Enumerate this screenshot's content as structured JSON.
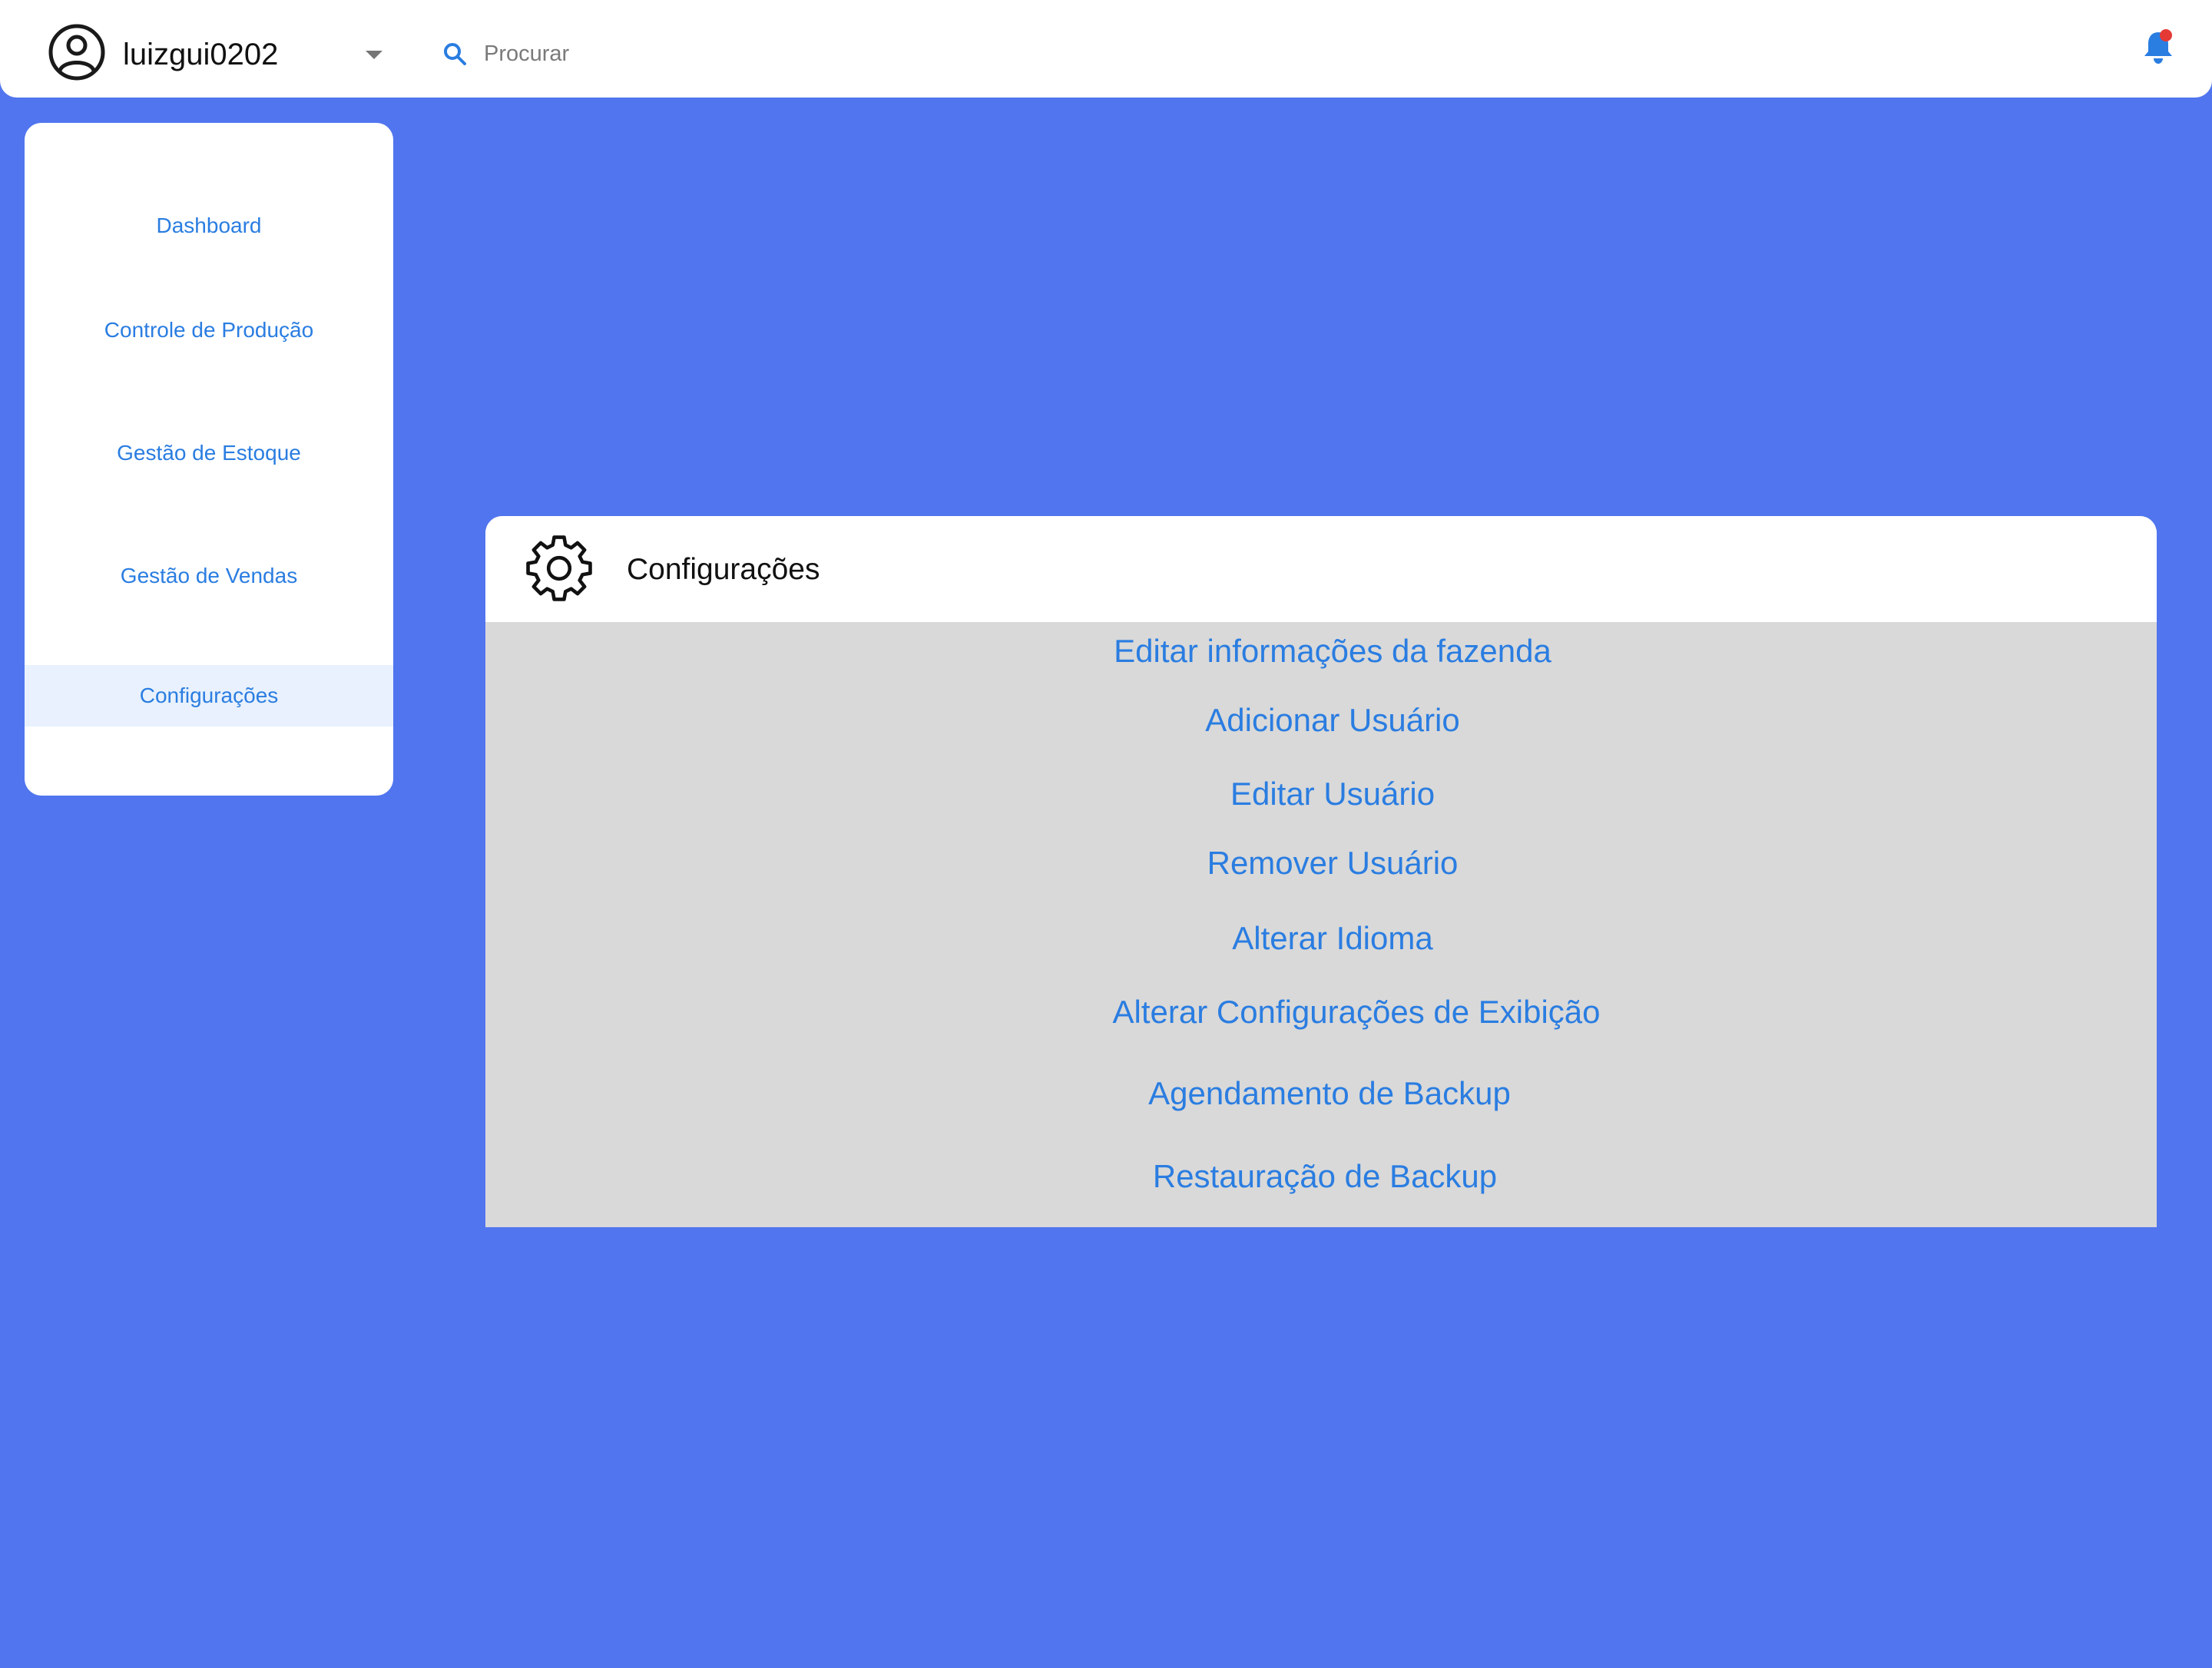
{
  "header": {
    "username": "luizgui0202",
    "search_placeholder": "Procurar",
    "icons": {
      "avatar": "user-circle-icon",
      "dropdown": "caret-down-icon",
      "search": "search-icon",
      "notification": "bell-icon"
    }
  },
  "sidebar": {
    "items": [
      {
        "label": "Dashboard",
        "active": false
      },
      {
        "label": "Controle de Produção",
        "active": false
      },
      {
        "label": "Gestão de Estoque",
        "active": false
      },
      {
        "label": "Gestão de Vendas",
        "active": false
      },
      {
        "label": "Configurações",
        "active": true
      }
    ]
  },
  "settings": {
    "title": "Configurações",
    "icon": "gear-icon",
    "options": [
      "Editar informações da fazenda",
      "Adicionar Usuário",
      "Editar Usuário",
      "Remover Usuário",
      "Alterar Idioma",
      "Alterar Configurações de Exibição",
      "Agendamento de Backup",
      "Restauração de Backup"
    ]
  },
  "colors": {
    "background": "#5175EF",
    "accent": "#2A7DE1",
    "panel": "#D9D9D9",
    "surface": "#FFFFFF",
    "active_item": "#E8F1FD",
    "notification_dot": "#E53935"
  }
}
